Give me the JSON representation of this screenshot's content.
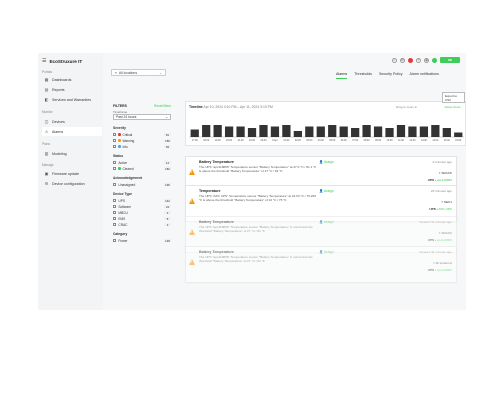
{
  "app": {
    "name": "EcoStruxure IT"
  },
  "sidebar": {
    "sections": [
      {
        "label": "Portals",
        "items": [
          {
            "label": "Dashboards",
            "icon": "dashboard-icon"
          },
          {
            "label": "Reports",
            "icon": "report-icon"
          },
          {
            "label": "Services and Warranties",
            "icon": "services-icon"
          }
        ]
      },
      {
        "label": "Monitor",
        "items": [
          {
            "label": "Devices",
            "icon": "device-icon"
          },
          {
            "label": "Alarms",
            "icon": "alarm-icon",
            "active": true
          }
        ]
      },
      {
        "label": "Plans",
        "items": [
          {
            "label": "Modeling",
            "icon": "modeling-icon"
          }
        ]
      },
      {
        "label": "Manage",
        "items": [
          {
            "label": "Firmware update",
            "icon": "firmware-icon"
          },
          {
            "label": "Device configuration",
            "icon": "config-icon"
          }
        ]
      }
    ]
  },
  "location_select": {
    "value": "All locations"
  },
  "tabs": [
    "Alarms",
    "Thresholds",
    "Security Policy",
    "Alarm notifications"
  ],
  "export": {
    "label": "Export to CSV"
  },
  "filters": {
    "title": "FILTERS",
    "reset": "Reset filters",
    "timeframe_label": "Timeframe",
    "timeframe_value": "Past 24 hours",
    "groups": [
      {
        "label": "Severity",
        "rows": [
          {
            "label": "Critical",
            "count": "81",
            "color": "#e53935"
          },
          {
            "label": "Warning",
            "count": "180",
            "color": "#f39c12"
          },
          {
            "label": "Info",
            "count": "84",
            "color": "#42a5f5"
          }
        ]
      },
      {
        "label": "Status",
        "rows": [
          {
            "label": "Active",
            "count": "14"
          },
          {
            "label": "Cleared",
            "count": "182",
            "color": "#3dcd58"
          }
        ]
      },
      {
        "label": "Acknowledgement",
        "rows": [
          {
            "label": "Unassigned",
            "count": "196"
          }
        ]
      },
      {
        "label": "Device Type",
        "rows": [
          {
            "label": "UPS",
            "count": "142"
          },
          {
            "label": "Software",
            "count": "24"
          },
          {
            "label": "MBCU",
            "count": "3"
          },
          {
            "label": "EMS",
            "count": "8"
          },
          {
            "label": "CRAC",
            "count": "3"
          }
        ]
      },
      {
        "label": "Category",
        "rows": [
          {
            "label": "Power",
            "count": "148"
          }
        ]
      }
    ]
  },
  "timeline": {
    "title": "Timeline",
    "range": "Apr 10, 2024 3:10 PM  –  Apr 11, 2024 3:10 PM",
    "drag_hint": "Drag to zoom in",
    "reset": "Reset Zoom"
  },
  "chart_data": {
    "type": "bar",
    "categories": [
      "17:00",
      "18:00",
      "19:00",
      "20:00",
      "21:00",
      "22:00",
      "23:00",
      "9 Apr",
      "01:00",
      "02:00",
      "03:00",
      "04:00",
      "05:00",
      "06:00",
      "07:00",
      "08:00",
      "09:00",
      "10:00",
      "11:00",
      "12:00",
      "13:00",
      "14:00",
      "15:00",
      "16:00"
    ],
    "values": [
      5,
      8,
      8,
      7,
      7,
      6,
      8,
      7,
      8,
      4,
      7,
      7,
      8,
      7,
      6,
      8,
      7,
      6,
      8,
      7,
      7,
      8,
      6,
      3
    ],
    "colors": {
      "bar": "#333333"
    }
  },
  "alarms": [
    {
      "title": "Battery Temperature",
      "assign": "Assign",
      "desc": "The UPS \"apc118865\" Temperature sensor \"Battery Temperature\" at 27.0 °C / 81.1 °F is above the threshold \"Battery Temperature\" of 27 °C / 81 °F.",
      "ago": "8 minutes ago",
      "location": "SRACK",
      "device_prefix": "UPS",
      "device": "apc118865",
      "faded": false
    },
    {
      "title": "Temperature",
      "assign": "Assign",
      "desc": "The UPS \"APC UPS\" Temperature sensor \"Battery Temperature\" at 24.03 °C / 75.269 °F is above the threshold \"Battery Temperature\" of 24 °C / 75 °F.",
      "ago": "26 minutes ago",
      "location": "SEC1",
      "device_prefix": "UPS",
      "device": "APC UPS",
      "faded": false
    },
    {
      "title": "Battery Temperature",
      "assign": "Assign",
      "desc": "The UPS \"apc118865\" Temperature sensor \"Battery Temperature\" is now below the threshold \"Battery Temperature\" of 27 °C / 81 °F.",
      "ago": "Cleared 32 minutes ago",
      "location": "SRACK",
      "device_prefix": "UPS",
      "device": "apc118865",
      "faded": true
    },
    {
      "title": "Battery Temperature",
      "assign": "Assign",
      "desc": "The UPS \"apc118865\" Temperature sensor \"Battery Temperature\" is now below the threshold \"Battery Temperature\" of 27 °C / 81 °F.",
      "ago": "Cleared 46 minutes ago",
      "location": "All locations",
      "device_prefix": "UPS",
      "device": "apc118865",
      "faded": true
    }
  ]
}
